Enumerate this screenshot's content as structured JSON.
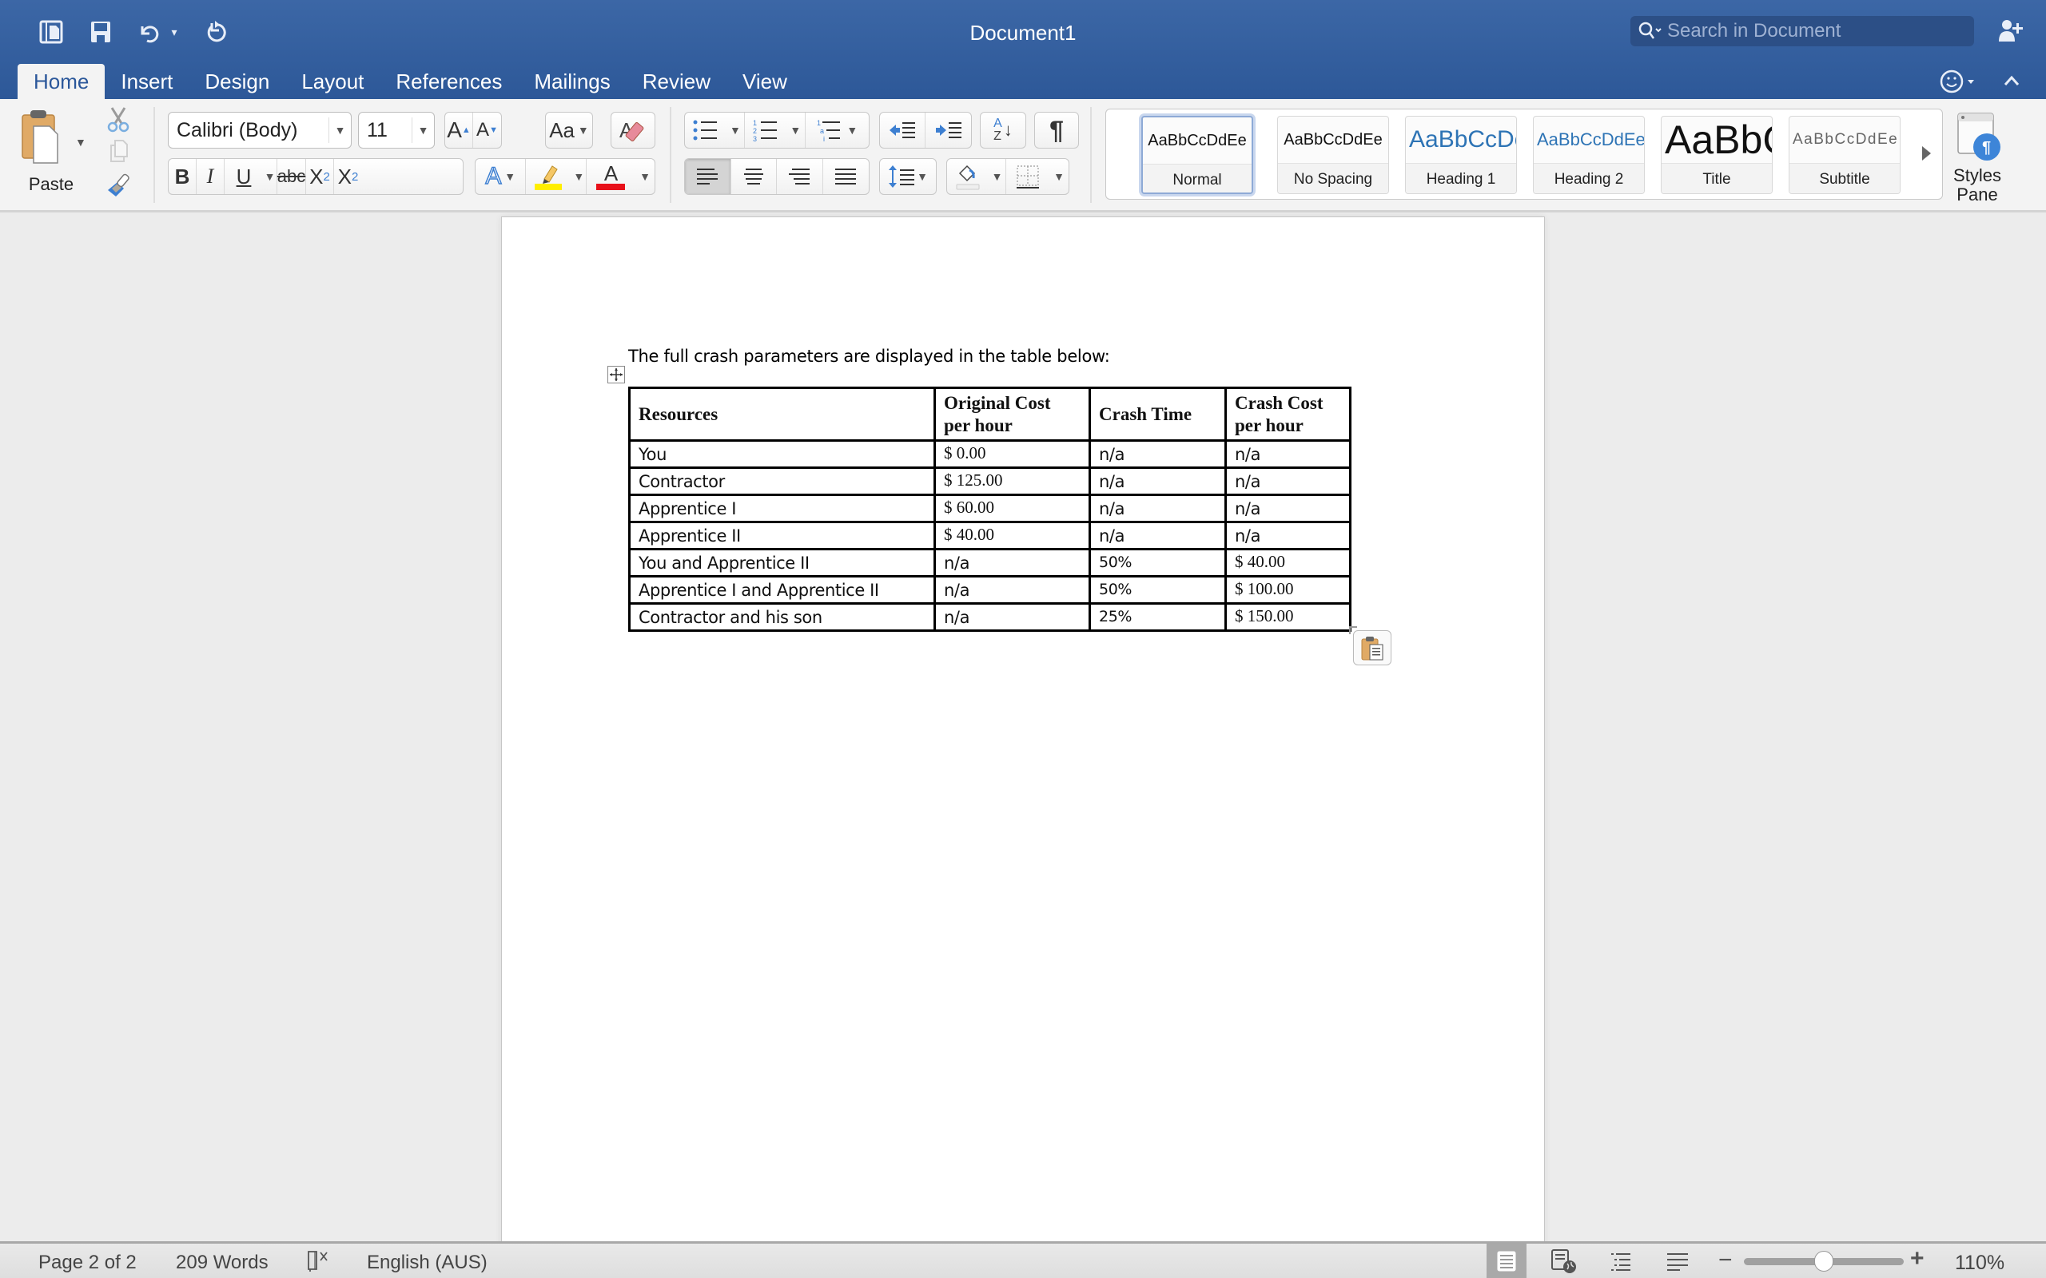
{
  "window": {
    "title": "Document1",
    "search_placeholder": "Search in Document"
  },
  "quick_access": [
    {
      "icon": "sidebar-toggle-icon"
    },
    {
      "icon": "save-icon"
    },
    {
      "icon": "undo-icon"
    },
    {
      "icon": "redo-icon"
    }
  ],
  "tabs": [
    {
      "label": "Home",
      "active": true
    },
    {
      "label": "Insert"
    },
    {
      "label": "Design"
    },
    {
      "label": "Layout"
    },
    {
      "label": "References"
    },
    {
      "label": "Mailings"
    },
    {
      "label": "Review"
    },
    {
      "label": "View"
    }
  ],
  "ribbon": {
    "clipboard": {
      "paste_label": "Paste"
    },
    "font": {
      "name": "Calibri (Body)",
      "size": "11",
      "grow_label": "A",
      "shrink_label": "A",
      "bold": "B",
      "italic": "I",
      "underline": "U",
      "strikethrough": "abc",
      "subscript": "X",
      "subscript_digit": "2",
      "superscript": "X",
      "superscript_digit": "2",
      "text_effects": "A",
      "font_color_letter": "A",
      "highlight_color": "#ffee00",
      "font_color": "#e8101a"
    },
    "paragraph": {
      "pilcrow": "¶",
      "sort_top": "A",
      "sort_bottom": "Z",
      "alignment_active": "left"
    },
    "styles": [
      {
        "sample": "AaBbCcDdEe",
        "name": "Normal",
        "selected": true
      },
      {
        "sample": "AaBbCcDdEe",
        "name": "No Spacing"
      },
      {
        "sample": "AaBbCcDc",
        "name": "Heading 1"
      },
      {
        "sample": "AaBbCcDdEe",
        "name": "Heading 2"
      },
      {
        "sample": "AaBbC",
        "name": "Title"
      },
      {
        "sample": "AaBbCcDdEe",
        "name": "Subtitle"
      }
    ],
    "styles_pane_label_1": "Styles",
    "styles_pane_label_2": "Pane",
    "heading_color": "#2e74b5"
  },
  "document": {
    "intro": "The full crash parameters are displayed in the table below:",
    "table": {
      "headers": [
        "Resources",
        "Original Cost per hour",
        "Crash Time",
        "Crash Cost per hour"
      ],
      "headers_wrapped": [
        [
          "Resources"
        ],
        [
          "Original Cost",
          "per hour"
        ],
        [
          "Crash Time"
        ],
        [
          "Crash Cost",
          "per hour"
        ]
      ],
      "rows": [
        [
          "You",
          "$ 0.00",
          "n/a",
          "n/a"
        ],
        [
          "Contractor",
          "$ 125.00",
          "n/a",
          "n/a"
        ],
        [
          "Apprentice I",
          "$ 60.00",
          "n/a",
          "n/a"
        ],
        [
          "Apprentice II",
          "$ 40.00",
          "n/a",
          "n/a"
        ],
        [
          "You and Apprentice II",
          "n/a",
          "50%",
          "$ 40.00"
        ],
        [
          "Apprentice I and Apprentice II",
          "n/a",
          "50%",
          "$ 100.00"
        ],
        [
          "Contractor and his son",
          "n/a",
          "25%",
          "$ 150.00"
        ]
      ]
    }
  },
  "status": {
    "page": "Page 2 of 2",
    "words": "209 Words",
    "language": "English (AUS)",
    "zoom": "110%",
    "zoom_slider_fraction": 0.5,
    "active_view": "print-layout"
  }
}
